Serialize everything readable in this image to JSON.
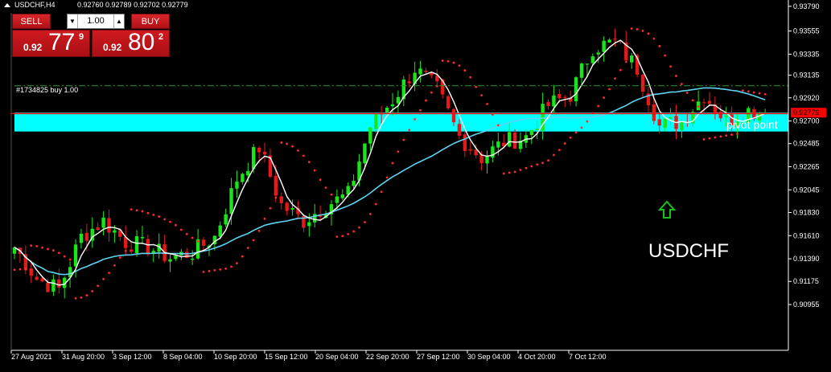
{
  "header": {
    "title": "USDCHF,H4",
    "ohlc": "0.92760 0.92789 0.92702 0.92779"
  },
  "trade_panel": {
    "sell_label": "SELL",
    "buy_label": "BUY",
    "lot": "1.00",
    "sell_price_small": "0.92",
    "sell_price_big": "77",
    "sell_price_sup": "9",
    "buy_price_small": "0.92",
    "buy_price_big": "80",
    "buy_price_sup": "2"
  },
  "colors": {
    "background": "#000000",
    "bull": "#19e619",
    "bear": "#e61919",
    "pivot": "#ff0000",
    "zone": "#00ffff",
    "ma_slow": "#5fd3f3",
    "ma_fast": "#ffffff",
    "sar": "#ff2a2a",
    "order": "#2f9b2f",
    "arrow": "#19c019",
    "current_price_tag": "#ff0000"
  },
  "chart_data": {
    "type": "candlestick",
    "symbol": "USDCHF",
    "timeframe": "H4",
    "ylim": [
      0.9052,
      0.9385
    ],
    "y_ticks": [
      "0.93790",
      "0.93555",
      "0.93335",
      "0.93135",
      "0.92920",
      "0.92700",
      "0.92485",
      "0.92265",
      "0.92045",
      "0.91830",
      "0.91610",
      "0.91390",
      "0.91175",
      "0.90955"
    ],
    "x_labels": [
      "27 Aug 2021",
      "31 Aug 20:00",
      "3 Sep 12:00",
      "8 Sep 04:00",
      "10 Sep 20:00",
      "15 Sep 12:00",
      "20 Sep 04:00",
      "22 Sep 20:00",
      "27 Sep 12:00",
      "30 Sep 04:00",
      "4 Oct 20:00",
      "7 Oct 12:00"
    ],
    "bar_count": 136,
    "close_anchors": [
      [
        0,
        0.915
      ],
      [
        4,
        0.912
      ],
      [
        8,
        0.911
      ],
      [
        12,
        0.916
      ],
      [
        16,
        0.9175
      ],
      [
        20,
        0.9155
      ],
      [
        24,
        0.915
      ],
      [
        28,
        0.914
      ],
      [
        32,
        0.9145
      ],
      [
        36,
        0.916
      ],
      [
        40,
        0.9215
      ],
      [
        44,
        0.9245
      ],
      [
        48,
        0.919
      ],
      [
        52,
        0.9175
      ],
      [
        56,
        0.919
      ],
      [
        60,
        0.92
      ],
      [
        64,
        0.9265
      ],
      [
        68,
        0.929
      ],
      [
        72,
        0.932
      ],
      [
        76,
        0.93
      ],
      [
        80,
        0.9255
      ],
      [
        84,
        0.9235
      ],
      [
        88,
        0.925
      ],
      [
        92,
        0.9255
      ],
      [
        96,
        0.9285
      ],
      [
        100,
        0.9295
      ],
      [
        104,
        0.934
      ],
      [
        108,
        0.9345
      ],
      [
        112,
        0.932
      ],
      [
        116,
        0.9265
      ],
      [
        120,
        0.927
      ],
      [
        124,
        0.9295
      ],
      [
        128,
        0.927
      ],
      [
        132,
        0.928
      ],
      [
        135,
        0.92779
      ]
    ],
    "current_price": "0.92779",
    "pivot_point": {
      "label": "pivot point",
      "value": 0.9277
    },
    "support_zone": {
      "from": 0.926,
      "to": 0.9278
    },
    "order_line": {
      "label": "#1734825 buy 1.00",
      "value": 0.93035
    },
    "indicators": [
      "moving average (slow)",
      "moving average (fast)",
      "parabolic SAR"
    ],
    "annotation": {
      "text": "USDCHF",
      "arrow": "up"
    },
    "grid": false,
    "legend": "none"
  }
}
